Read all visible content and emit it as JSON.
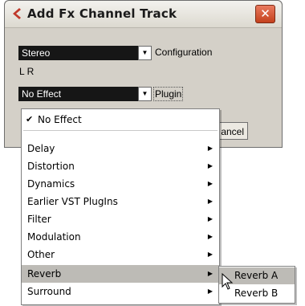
{
  "dialog": {
    "title": "Add Fx Channel Track",
    "close_label": "✕",
    "configuration_value": "Stereo",
    "configuration_label": "Configuration",
    "channels_label": "L R",
    "plugin_value": "No Effect",
    "plugin_label": "Plugin",
    "cancel_label": "ancel"
  },
  "menu": {
    "checked_item": "No Effect",
    "items": [
      {
        "label": "Delay",
        "has_submenu": true
      },
      {
        "label": "Distortion",
        "has_submenu": true
      },
      {
        "label": "Dynamics",
        "has_submenu": true
      },
      {
        "label": "Earlier VST PlugIns",
        "has_submenu": true
      },
      {
        "label": "Filter",
        "has_submenu": true
      },
      {
        "label": "Modulation",
        "has_submenu": true
      },
      {
        "label": "Other",
        "has_submenu": true
      },
      {
        "label": "Reverb",
        "has_submenu": true
      },
      {
        "label": "Surround",
        "has_submenu": true
      }
    ],
    "submenu": [
      "Reverb A",
      "Reverb B"
    ]
  },
  "icons": {
    "check": "✔",
    "submenu_arrow": "▶",
    "dropdown_arrow": "▼"
  },
  "colors": {
    "combo_bg": "#161616",
    "highlight": "#bdbbb6",
    "close_button": "#c4411d",
    "logo": "#c0392b"
  }
}
